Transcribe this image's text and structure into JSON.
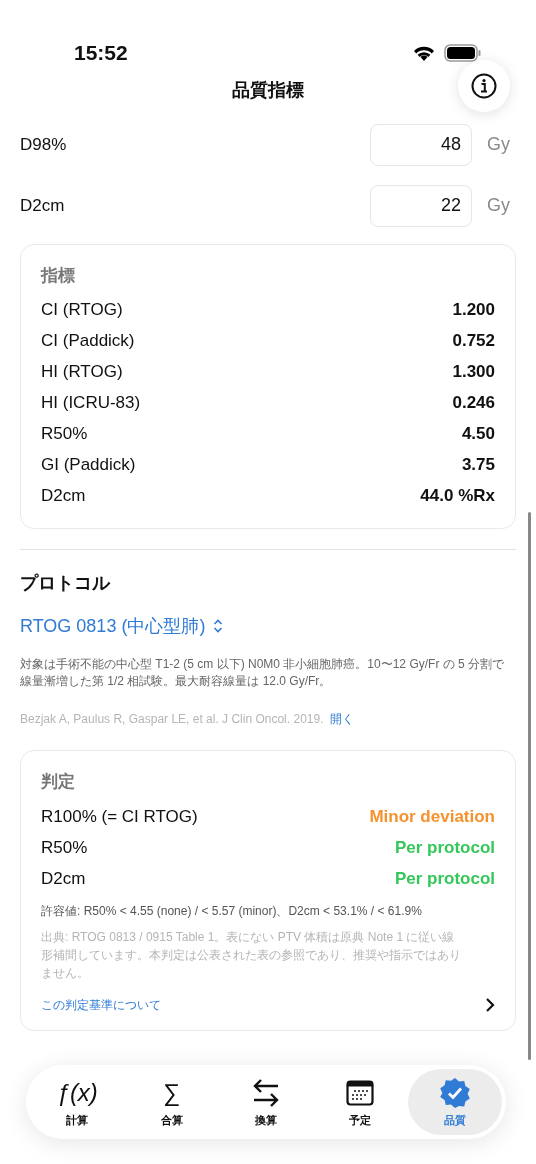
{
  "status_bar": {
    "time": "15:52"
  },
  "header": {
    "title": "品質指標"
  },
  "inputs": [
    {
      "label": "D98%",
      "value": "48",
      "unit": "Gy"
    },
    {
      "label": "D2cm",
      "value": "22",
      "unit": "Gy"
    }
  ],
  "indices": {
    "title": "指標",
    "rows": [
      {
        "label": "CI (RTOG)",
        "value": "1.200"
      },
      {
        "label": "CI (Paddick)",
        "value": "0.752"
      },
      {
        "label": "HI (RTOG)",
        "value": "1.300"
      },
      {
        "label": "HI (ICRU-83)",
        "value": "0.246"
      },
      {
        "label": "R50%",
        "value": "4.50"
      },
      {
        "label": "GI (Paddick)",
        "value": "3.75"
      },
      {
        "label": "D2cm",
        "value": "44.0 %Rx"
      }
    ]
  },
  "protocol": {
    "title": "プロトコル",
    "selection": "RTOG 0813 (中心型肺)",
    "description": "対象は手術不能の中心型 T1-2 (5 cm 以下) N0M0 非小細胞肺癌。10〜12 Gy/Fr の 5 分割で線量漸増した第 1/2 相試験。最大耐容線量は 12.0 Gy/Fr。",
    "citation": "Bezjak A, Paulus R, Gaspar LE, et al. J Clin Oncol. 2019.",
    "open_link": "開く"
  },
  "verdict": {
    "title": "判定",
    "rows": [
      {
        "label": "R100% (= CI RTOG)",
        "result": "Minor deviation",
        "color": "#f7912e"
      },
      {
        "label": "R50%",
        "result": "Per protocol",
        "color": "#34c759"
      },
      {
        "label": "D2cm",
        "result": "Per protocol",
        "color": "#34c759"
      }
    ],
    "tolerance": "許容値: R50% < 4.55 (none) / < 5.57 (minor)、D2cm < 53.1% / < 61.9%",
    "source": "出典: RTOG 0813 / 0915 Table 1。表にない PTV 体積は原典 Note 1 に従い線形補間しています。本判定は公表された表の参照であり、推奨や指示ではありません。",
    "link": "この判定基準について"
  },
  "tabs": [
    {
      "label": "計算",
      "kind": "symbol",
      "symbol": "ƒ(x)",
      "selected": false
    },
    {
      "label": "合算",
      "kind": "symbol",
      "symbol": "∑",
      "selected": false
    },
    {
      "label": "換算",
      "kind": "arrows",
      "selected": false
    },
    {
      "label": "予定",
      "kind": "calendar",
      "selected": false
    },
    {
      "label": "品質",
      "kind": "badge",
      "selected": true
    }
  ]
}
